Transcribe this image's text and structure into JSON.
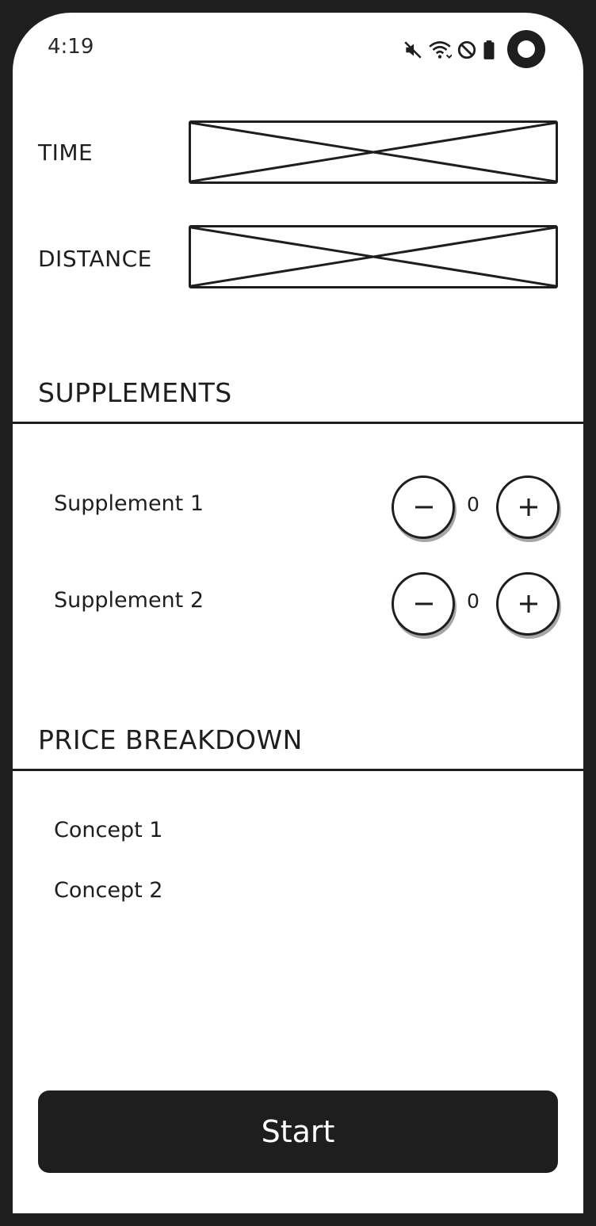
{
  "status_bar": {
    "time": "4:19",
    "icons": [
      "mute-icon",
      "wifi-icon",
      "do-not-disturb-icon",
      "battery-icon"
    ]
  },
  "form": {
    "time_label": "TIME",
    "distance_label": "DISTANCE"
  },
  "supplements": {
    "title": "SUPPLEMENTS",
    "items": [
      {
        "label": "Supplement 1",
        "count": "0"
      },
      {
        "label": "Supplement 2",
        "count": "0"
      }
    ]
  },
  "price_breakdown": {
    "title": "PRICE BREAKDOWN",
    "concepts": [
      {
        "label": "Concept 1"
      },
      {
        "label": "Concept 2"
      }
    ]
  },
  "actions": {
    "start_label": "Start"
  },
  "colors": {
    "ink": "#1e1e1e",
    "background": "#ffffff"
  }
}
